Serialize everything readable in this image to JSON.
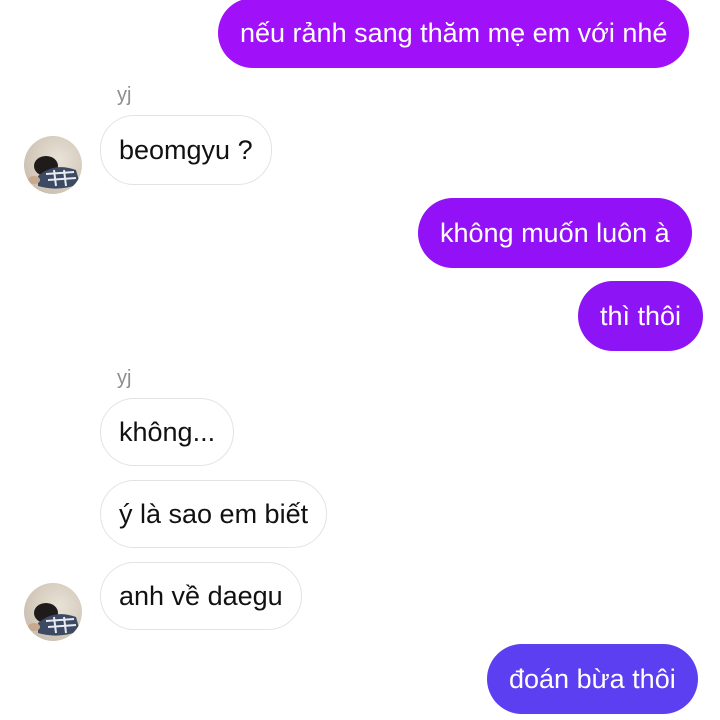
{
  "conversation": {
    "messages": [
      {
        "text": "nếu rảnh sang thăm mẹ em với nhé"
      },
      {
        "sender": "yj"
      },
      {
        "text": "beomgyu ?"
      },
      {
        "text": "không muốn luôn à"
      },
      {
        "text": "thì thôi"
      },
      {
        "sender": "yj"
      },
      {
        "text": "không..."
      },
      {
        "text": "ý là sao em biết"
      },
      {
        "text": "anh về daegu"
      },
      {
        "text": "đoán bừa thôi"
      }
    ]
  },
  "colors": {
    "outgoing_top": "#9b0ff7",
    "outgoing_bottom": "#5a3cf0",
    "incoming_bg": "#ffffff",
    "incoming_border": "#e3e3e3",
    "sender_text": "#8e8e8e"
  },
  "icons": {
    "avatar": "avatar-photo"
  }
}
